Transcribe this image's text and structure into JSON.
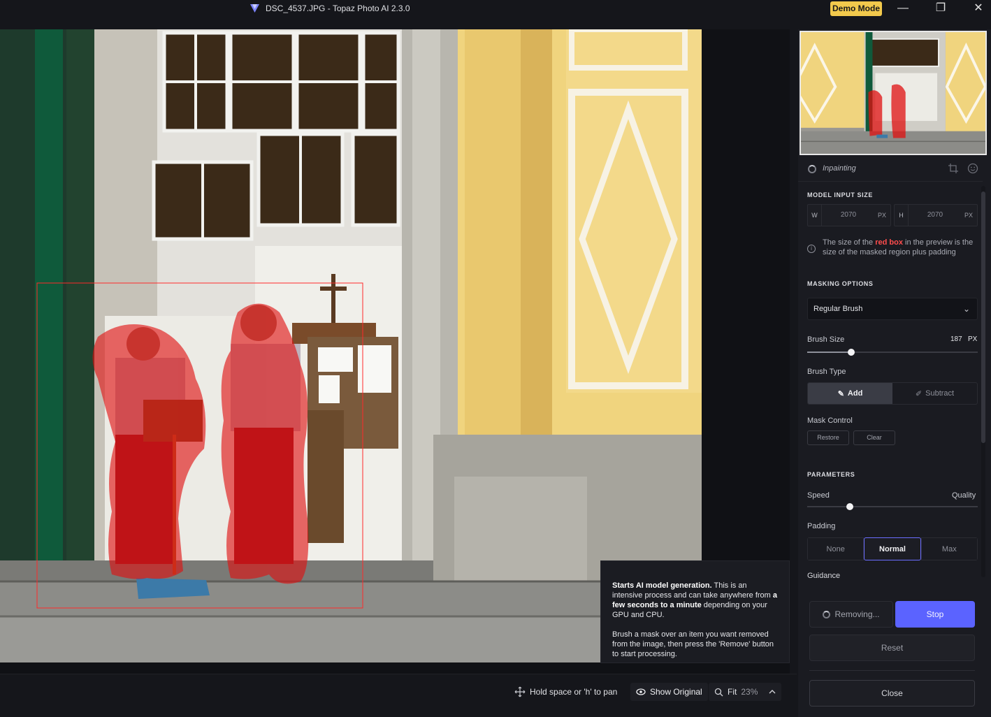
{
  "window": {
    "title": "DSC_4537.JPG - Topaz Photo AI 2.3.0",
    "demo_badge": "Demo Mode",
    "minimize": "—",
    "maximize": "❐",
    "close": "✕"
  },
  "panel": {
    "title": "Inpainting",
    "model_input_size": {
      "label": "MODEL INPUT SIZE",
      "width": {
        "label": "W",
        "value": "2070",
        "unit": "PX"
      },
      "height": {
        "label": "H",
        "value": "2070",
        "unit": "PX"
      }
    },
    "info_note": {
      "part1": "The size of the ",
      "highlight": "red box",
      "part2": " in the preview is the size of the masked region plus padding"
    },
    "masking_options": {
      "label": "MASKING OPTIONS",
      "selected": "Regular Brush",
      "brush_size": {
        "label": "Brush Size",
        "value": "187",
        "unit": "PX",
        "fraction": 0.26
      },
      "brush_type": {
        "label": "Brush Type",
        "options": [
          "Add",
          "Subtract"
        ],
        "selected": "Add"
      },
      "mask_control": {
        "label": "Mask Control",
        "restore": "Restore",
        "clear": "Clear"
      }
    },
    "parameters": {
      "label": "PARAMETERS",
      "speed_label": "Speed",
      "quality_label": "Quality",
      "speed_quality_fraction": 0.25,
      "padding": {
        "label": "Padding",
        "options": [
          "None",
          "Normal",
          "Max"
        ],
        "selected": "Normal"
      },
      "guidance_label": "Guidance"
    },
    "actions": {
      "removing": "Removing...",
      "stop": "Stop",
      "reset": "Reset",
      "close": "Close"
    }
  },
  "tooltip": {
    "bold1": "Starts AI model generation.",
    "text1": " This is an intensive process and can take anywhere from ",
    "bold2": "a few seconds to a minute",
    "text2": " depending on your GPU and CPU.",
    "para2": "Brush a mask over an item you want removed from the image, then press the 'Remove' button to start processing."
  },
  "bottombar": {
    "pan_hint": "Hold space or 'h' to pan",
    "show_original": "Show Original",
    "zoom_label": "Fit",
    "zoom_value": "23%"
  },
  "colors": {
    "accent": "#5b63ff",
    "mask": "#e01010",
    "demo": "#f2c94c",
    "wall": "#f3d98a"
  },
  "icons": [
    "topaz-logo-icon",
    "spinner-icon",
    "crop-icon",
    "face-icon",
    "info-icon",
    "chevron-down-icon",
    "brush-icon",
    "eraser-icon",
    "move-icon",
    "eye-icon",
    "zoom-icon",
    "chevron-up-icon"
  ]
}
